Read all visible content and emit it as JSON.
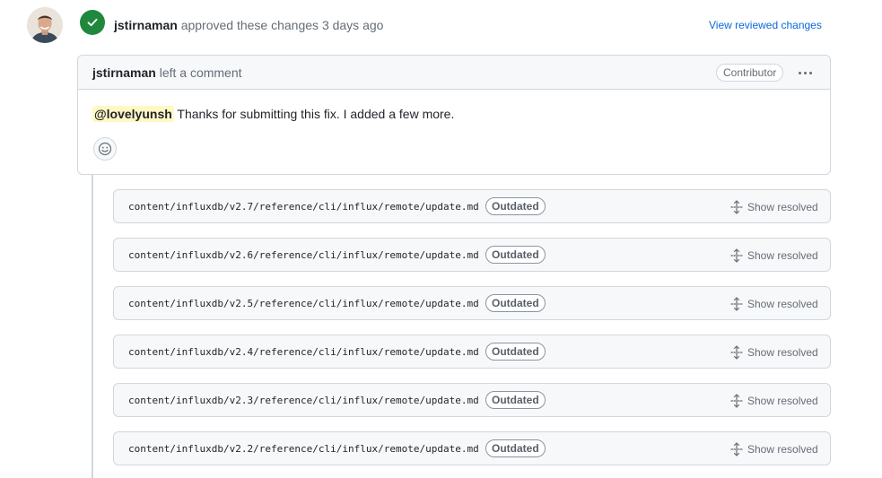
{
  "review_event": {
    "author": "jstirnaman",
    "action_text": " approved these changes ",
    "time_text": "3 days ago",
    "view_reviewed_label": "View reviewed changes"
  },
  "comment": {
    "author": "jstirnaman",
    "header_text": " left a comment",
    "author_badge": "Contributor",
    "mention": "@lovelyunsh",
    "body_text": " Thanks for submitting this fix. I added a few more."
  },
  "files": [
    {
      "path": "content/influxdb/v2.7/reference/cli/influx/remote/update.md",
      "status": "Outdated",
      "action": "Show resolved"
    },
    {
      "path": "content/influxdb/v2.6/reference/cli/influx/remote/update.md",
      "status": "Outdated",
      "action": "Show resolved"
    },
    {
      "path": "content/influxdb/v2.5/reference/cli/influx/remote/update.md",
      "status": "Outdated",
      "action": "Show resolved"
    },
    {
      "path": "content/influxdb/v2.4/reference/cli/influx/remote/update.md",
      "status": "Outdated",
      "action": "Show resolved"
    },
    {
      "path": "content/influxdb/v2.3/reference/cli/influx/remote/update.md",
      "status": "Outdated",
      "action": "Show resolved"
    },
    {
      "path": "content/influxdb/v2.2/reference/cli/influx/remote/update.md",
      "status": "Outdated",
      "action": "Show resolved"
    }
  ],
  "icons": {
    "approved": "check-circle-icon",
    "reaction": "smiley-icon",
    "menu": "kebab-horizontal-icon",
    "show_resolved": "unfold-icon"
  },
  "colors": {
    "approved_green": "#1f883d",
    "link_blue": "#0969da",
    "mention_bg": "#fff8c5",
    "border": "#d0d7de",
    "muted_text": "#656d76"
  }
}
